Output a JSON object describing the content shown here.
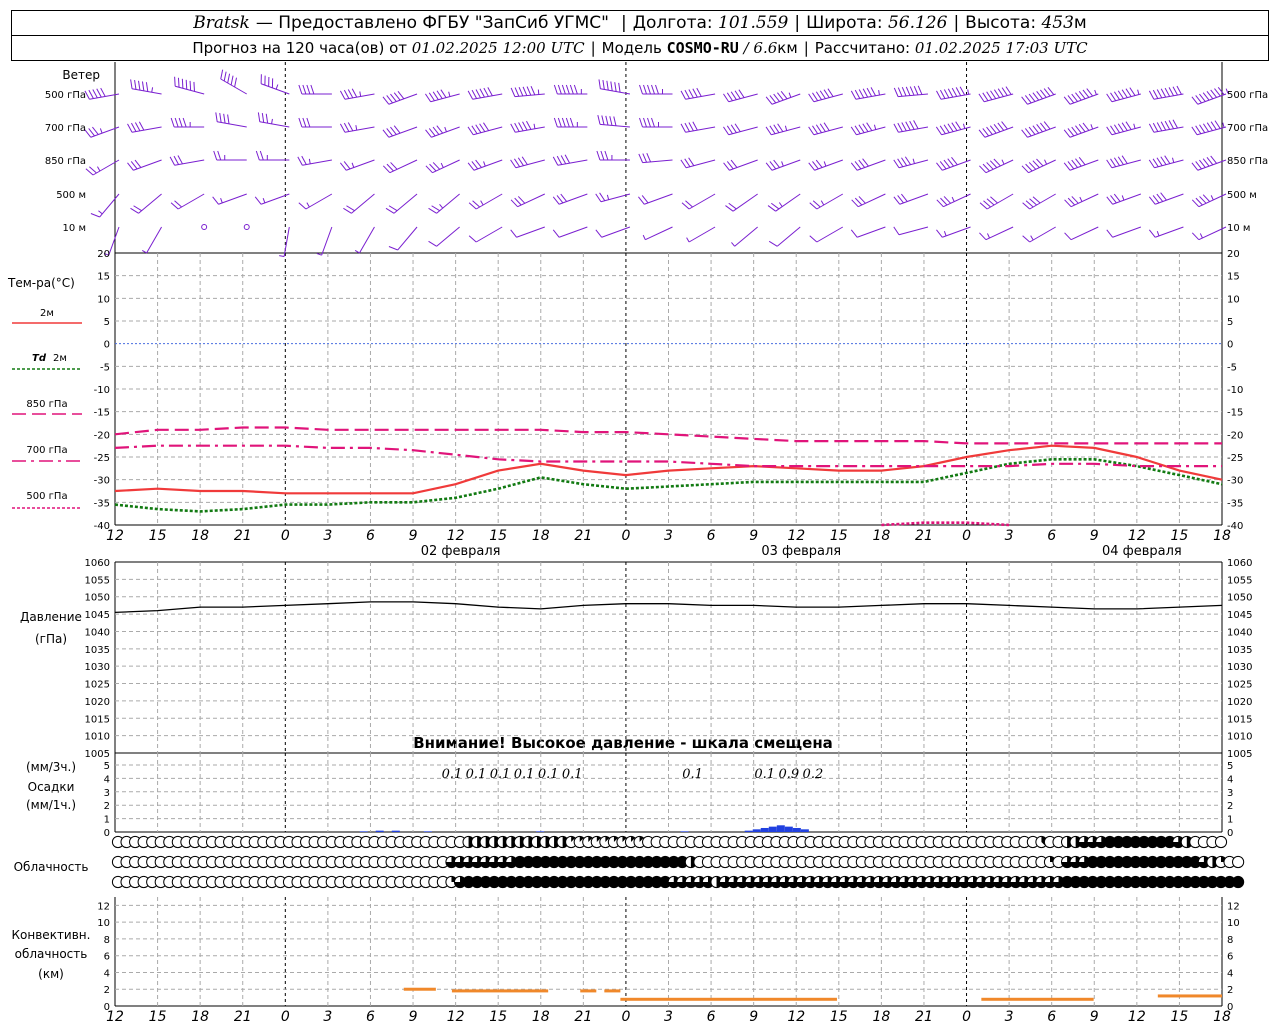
{
  "header": {
    "station": "Bratsk",
    "provided": "— Предоставлено ФГБУ \"ЗапСиб УГМС\"",
    "lon_label": "Долгота:",
    "lon_value": "101.559",
    "lat_label": "Широта:",
    "lat_value": "56.126",
    "alt_label": "Высота:",
    "alt_value": "453",
    "alt_unit": "м",
    "forecast_label": "Прогноз на 120 часа(ов) от",
    "forecast_start": "01.02.2025 12:00 UTC",
    "model_label": "Модель",
    "model_name": "COSMO-RU",
    "model_res": "/ 6.6",
    "model_res_unit": "км",
    "calc_label": "Рассчитано:",
    "calc_time": "01.02.2025 17:03 UTC"
  },
  "labels": {
    "wind": "Ветер",
    "temp": "Тем-ра(°С)",
    "t2m": "2м",
    "td": "Td",
    "td2m": "2м",
    "t850": "850 гПа",
    "t700": "700 гПа",
    "t500": "500 гПа",
    "pressure": "Давление",
    "pressure_unit": "(гПа)",
    "warning": "Внимание! Высокое давление - шкала смещена",
    "precip_unit1": "(мм/3ч.)",
    "precip": "Осадки",
    "precip_unit2": "(мм/1ч.)",
    "clouds": "Облачность",
    "conv1": "Конвективн.",
    "conv2": "облачность",
    "conv3": "(км)"
  },
  "colors": {
    "wind": "#7a1fd0",
    "t2m": "#f03a3a",
    "td": "#127a12",
    "t850": "#e0147a",
    "t700": "#e0147a",
    "t500": "#e0147a",
    "zero": "#4a6ee0",
    "pressure": "#000000",
    "precip": "#2040e0",
    "conv": "#f0882a"
  },
  "chart_data": [
    {
      "type": "wind-barbs",
      "levels": [
        "500 гПа",
        "700 гПа",
        "850 гПа",
        "500 м",
        "10 м"
      ],
      "x_hours": [
        0,
        3,
        6,
        9,
        12,
        15,
        18,
        21,
        24,
        27,
        30,
        33,
        36,
        39,
        42,
        45,
        48,
        51,
        54,
        57,
        60,
        63,
        66,
        69,
        72,
        75,
        78
      ],
      "direction_deg": [
        [
          260,
          280,
          285,
          300,
          290,
          270,
          260,
          250,
          255,
          260,
          265,
          270,
          280,
          270,
          260,
          255,
          250,
          255,
          260,
          265,
          260,
          255,
          250,
          250,
          255,
          260,
          250
        ],
        [
          250,
          260,
          270,
          280,
          280,
          270,
          260,
          250,
          250,
          255,
          260,
          270,
          275,
          270,
          260,
          255,
          255,
          255,
          255,
          260,
          255,
          250,
          250,
          250,
          255,
          260,
          255
        ],
        [
          240,
          250,
          260,
          270,
          270,
          260,
          250,
          245,
          245,
          250,
          255,
          260,
          270,
          265,
          255,
          250,
          250,
          250,
          250,
          255,
          250,
          245,
          245,
          250,
          255,
          255,
          250
        ],
        [
          220,
          230,
          240,
          250,
          250,
          240,
          230,
          230,
          230,
          240,
          245,
          250,
          255,
          250,
          240,
          235,
          235,
          240,
          245,
          250,
          245,
          240,
          240,
          245,
          250,
          250,
          245
        ],
        [
          200,
          210,
          220,
          200,
          190,
          200,
          210,
          220,
          230,
          240,
          250,
          250,
          250,
          245,
          240,
          230,
          230,
          240,
          250,
          255,
          250,
          245,
          240,
          245,
          250,
          250,
          245
        ]
      ],
      "speed_ms": [
        [
          20,
          22,
          24,
          20,
          18,
          16,
          18,
          20,
          22,
          24,
          26,
          26,
          24,
          22,
          20,
          20,
          22,
          24,
          26,
          28,
          30,
          32,
          32,
          30,
          30,
          32,
          34
        ],
        [
          14,
          16,
          18,
          16,
          14,
          12,
          14,
          16,
          18,
          20,
          22,
          22,
          20,
          18,
          16,
          16,
          18,
          20,
          22,
          24,
          26,
          28,
          28,
          26,
          26,
          28,
          30
        ],
        [
          10,
          12,
          12,
          10,
          10,
          10,
          10,
          12,
          14,
          14,
          16,
          16,
          14,
          12,
          12,
          12,
          14,
          14,
          16,
          18,
          20,
          22,
          22,
          20,
          20,
          22,
          24
        ],
        [
          6,
          8,
          8,
          6,
          6,
          6,
          8,
          8,
          10,
          10,
          12,
          12,
          10,
          8,
          8,
          8,
          10,
          10,
          12,
          12,
          14,
          16,
          16,
          14,
          14,
          16,
          18
        ],
        [
          2,
          2,
          1,
          1,
          2,
          2,
          3,
          4,
          4,
          5,
          5,
          5,
          4,
          3,
          3,
          3,
          4,
          4,
          5,
          5,
          6,
          6,
          6,
          5,
          5,
          6,
          6
        ]
      ]
    },
    {
      "type": "line",
      "title": "Тем-ра(°С)",
      "ylim": [
        -40,
        20
      ],
      "yticks": [
        20,
        15,
        10,
        5,
        0,
        -5,
        -10,
        -15,
        -20,
        -25,
        -30,
        -35,
        -40
      ],
      "x": [
        0,
        3,
        6,
        9,
        12,
        15,
        18,
        21,
        24,
        27,
        30,
        33,
        36,
        39,
        42,
        45,
        48,
        51,
        54,
        57,
        60,
        63,
        66,
        69,
        72,
        75,
        78
      ],
      "series": [
        {
          "name": "2м",
          "values": [
            -32.5,
            -32,
            -32.5,
            -32.5,
            -33,
            -33,
            -33,
            -33,
            -31,
            -28,
            -26.5,
            -28,
            -29,
            -28,
            -27.5,
            -27,
            -27.5,
            -28,
            -28,
            -27,
            -25,
            -23.5,
            -22.5,
            -23,
            -25,
            -28,
            -30
          ]
        },
        {
          "name": "Td 2м",
          "values": [
            -35.5,
            -36.5,
            -37,
            -36.5,
            -35.5,
            -35.5,
            -35,
            -35,
            -34,
            -32,
            -29.5,
            -31,
            -32,
            -31.5,
            -31,
            -30.5,
            -30.5,
            -30.5,
            -30.5,
            -30.5,
            -28.5,
            -26.5,
            -25.5,
            -25.5,
            -27,
            -29,
            -31
          ]
        },
        {
          "name": "850 гПа",
          "values": [
            -20,
            -19,
            -19,
            -18.5,
            -18.5,
            -19,
            -19,
            -19,
            -19,
            -19,
            -19,
            -19.5,
            -19.5,
            -20,
            -20.5,
            -21,
            -21.5,
            -21.5,
            -21.5,
            -21.5,
            -22,
            -22,
            -22,
            -22,
            -22,
            -22,
            -22
          ]
        },
        {
          "name": "700 гПа",
          "values": [
            -23,
            -22.5,
            -22.5,
            -22.5,
            -22.5,
            -23,
            -23,
            -23.5,
            -24.5,
            -25.5,
            -26,
            -26,
            -26,
            -26,
            -26.5,
            -27,
            -27,
            -27,
            -27,
            -27,
            -27,
            -27,
            -26.5,
            -26.5,
            -27,
            -27,
            -27
          ]
        },
        {
          "name": "500 гПа",
          "values": [
            null,
            null,
            null,
            null,
            null,
            null,
            null,
            null,
            null,
            null,
            null,
            null,
            null,
            null,
            null,
            null,
            null,
            null,
            -40,
            -39.5,
            -39.5,
            -40,
            null,
            null,
            null,
            null,
            null
          ]
        }
      ],
      "x_tick_labels": [
        "12",
        "15",
        "18",
        "21",
        "0",
        "3",
        "6",
        "9",
        "12",
        "15",
        "18",
        "21",
        "0",
        "3",
        "6",
        "9",
        "12",
        "15",
        "18",
        "21",
        "0",
        "3",
        "6",
        "9",
        "12",
        "15",
        "18"
      ],
      "date_labels": [
        "02 февраля",
        "03 февраля",
        "04 февраля"
      ]
    },
    {
      "type": "line",
      "title": "Давление",
      "ylabel": "(гПа)",
      "ylim": [
        1005,
        1060
      ],
      "yticks": [
        1060,
        1055,
        1050,
        1045,
        1040,
        1035,
        1030,
        1025,
        1020,
        1015,
        1010,
        1005
      ],
      "x": [
        0,
        3,
        6,
        9,
        12,
        15,
        18,
        21,
        24,
        27,
        30,
        33,
        36,
        39,
        42,
        45,
        48,
        51,
        54,
        57,
        60,
        63,
        66,
        69,
        72,
        75,
        78
      ],
      "series": [
        {
          "name": "Давление",
          "values": [
            1045.5,
            1046,
            1047,
            1047,
            1047.5,
            1048,
            1048.5,
            1048.5,
            1048,
            1047,
            1046.5,
            1047.5,
            1048,
            1048,
            1047.5,
            1047.5,
            1047,
            1047,
            1047.5,
            1048,
            1048,
            1047.5,
            1047,
            1046.5,
            1046.5,
            1047,
            1047.5
          ]
        }
      ]
    },
    {
      "type": "bar",
      "title": "Осадки",
      "ylim": [
        0,
        5
      ],
      "yticks": [
        5,
        4,
        3,
        2,
        1,
        0
      ],
      "labels_3h": [
        {
          "hour": 42,
          "text": "0.1"
        },
        {
          "hour": 45,
          "text": "0.1"
        },
        {
          "hour": 48,
          "text": "0.1"
        },
        {
          "hour": 51,
          "text": "0.1"
        },
        {
          "hour": 54,
          "text": "0.1"
        },
        {
          "hour": 57,
          "text": "0.1"
        },
        {
          "hour": 72,
          "text": "0.1"
        },
        {
          "hour": 81,
          "text": "0.1"
        },
        {
          "hour": 84,
          "text": "0.9"
        },
        {
          "hour": 87,
          "text": "0.2"
        }
      ],
      "hourly_mm": [
        {
          "hour": 31,
          "value": 0.05
        },
        {
          "hour": 33,
          "value": 0.1
        },
        {
          "hour": 35,
          "value": 0.1
        },
        {
          "hour": 39,
          "value": 0.05
        },
        {
          "hour": 53,
          "value": 0.05
        },
        {
          "hour": 71,
          "value": 0.05
        },
        {
          "hour": 79,
          "value": 0.1
        },
        {
          "hour": 80,
          "value": 0.2
        },
        {
          "hour": 81,
          "value": 0.3
        },
        {
          "hour": 82,
          "value": 0.4
        },
        {
          "hour": 83,
          "value": 0.5
        },
        {
          "hour": 84,
          "value": 0.4
        },
        {
          "hour": 85,
          "value": 0.3
        },
        {
          "hour": 86,
          "value": 0.2
        }
      ]
    },
    {
      "type": "cloud-symbols",
      "title": "Облачность",
      "levels": [
        "upper",
        "middle",
        "lower"
      ],
      "cover_octas": [
        [
          0,
          0,
          0,
          0,
          0,
          0,
          0,
          0,
          0,
          0,
          0,
          0,
          0,
          0,
          0,
          0,
          0,
          0,
          0,
          0,
          0,
          0,
          0,
          0,
          0,
          0,
          0,
          0,
          0,
          0,
          0,
          0,
          0,
          0,
          0,
          0,
          0,
          0,
          0,
          0,
          0,
          4,
          4,
          4,
          4,
          4,
          4,
          4,
          4,
          4,
          4,
          4,
          4,
          1,
          1,
          1,
          1,
          1,
          1,
          1,
          1,
          1,
          0,
          0,
          0,
          0,
          0,
          0,
          0,
          0,
          0,
          0,
          0,
          0,
          0,
          0,
          0,
          0,
          0,
          0,
          0,
          0,
          0,
          0,
          0,
          0,
          0,
          0,
          0,
          0,
          0,
          0,
          0,
          0,
          0,
          0,
          0,
          0,
          0,
          0,
          0,
          0,
          0,
          0,
          0,
          0,
          0,
          0,
          3,
          0,
          0,
          4,
          4,
          6,
          6,
          6,
          8,
          8,
          8,
          8,
          8,
          8,
          8,
          8,
          6,
          4,
          0,
          0,
          0,
          0
        ],
        [
          0,
          0,
          0,
          0,
          0,
          0,
          0,
          0,
          0,
          0,
          0,
          0,
          0,
          0,
          0,
          0,
          0,
          0,
          0,
          0,
          0,
          0,
          0,
          0,
          0,
          0,
          0,
          0,
          0,
          0,
          0,
          0,
          0,
          0,
          0,
          0,
          0,
          0,
          0,
          6,
          6,
          6,
          6,
          6,
          6,
          6,
          6,
          8,
          8,
          8,
          8,
          8,
          8,
          8,
          8,
          8,
          8,
          8,
          8,
          8,
          8,
          8,
          8,
          8,
          8,
          8,
          8,
          4,
          0,
          0,
          0,
          0,
          0,
          0,
          0,
          0,
          0,
          0,
          0,
          0,
          0,
          0,
          0,
          0,
          0,
          0,
          0,
          0,
          0,
          0,
          0,
          0,
          0,
          0,
          0,
          0,
          0,
          0,
          0,
          0,
          0,
          0,
          0,
          0,
          0,
          0,
          0,
          0,
          0,
          2,
          0,
          6,
          6,
          6,
          8,
          8,
          8,
          8,
          8,
          8,
          8,
          8,
          8,
          8,
          8,
          8,
          8,
          6,
          4,
          2,
          0,
          0
        ],
        [
          0,
          0,
          0,
          0,
          0,
          0,
          0,
          0,
          0,
          0,
          0,
          0,
          0,
          0,
          0,
          0,
          0,
          0,
          0,
          0,
          0,
          0,
          0,
          0,
          0,
          0,
          0,
          0,
          0,
          0,
          0,
          0,
          0,
          0,
          0,
          0,
          0,
          0,
          0,
          2,
          6,
          8,
          8,
          8,
          8,
          8,
          8,
          8,
          8,
          8,
          8,
          8,
          8,
          8,
          8,
          8,
          8,
          8,
          8,
          8,
          8,
          8,
          8,
          8,
          8,
          6,
          6,
          6,
          6,
          6,
          4,
          6,
          6,
          6,
          6,
          6,
          6,
          6,
          6,
          6,
          6,
          6,
          6,
          6,
          6,
          6,
          6,
          6,
          6,
          6,
          6,
          6,
          6,
          6,
          6,
          6,
          6,
          6,
          6,
          6,
          6,
          6,
          6,
          6,
          6,
          6,
          6,
          6,
          6,
          6,
          6,
          8,
          8,
          8,
          8,
          8,
          8,
          8,
          8,
          8,
          8,
          8,
          8,
          8,
          8,
          8,
          8,
          8,
          8,
          8,
          8,
          8
        ]
      ]
    },
    {
      "type": "bar",
      "title": "Конвективн. облачность (км)",
      "ylim": [
        0,
        13
      ],
      "yticks": [
        12,
        10,
        8,
        6,
        4,
        2,
        0
      ],
      "segments": [
        {
          "from_hour": 36,
          "to_hour": 40,
          "top_km": 2.0
        },
        {
          "from_hour": 42,
          "to_hour": 54,
          "top_km": 1.8
        },
        {
          "from_hour": 58,
          "to_hour": 60,
          "top_km": 1.8
        },
        {
          "from_hour": 61,
          "to_hour": 63,
          "top_km": 1.8
        },
        {
          "from_hour": 63,
          "to_hour": 90,
          "top_km": 0.8
        },
        {
          "from_hour": 108,
          "to_hour": 122,
          "top_km": 0.8
        },
        {
          "from_hour": 130,
          "to_hour": 138,
          "top_km": 1.2
        }
      ]
    }
  ]
}
